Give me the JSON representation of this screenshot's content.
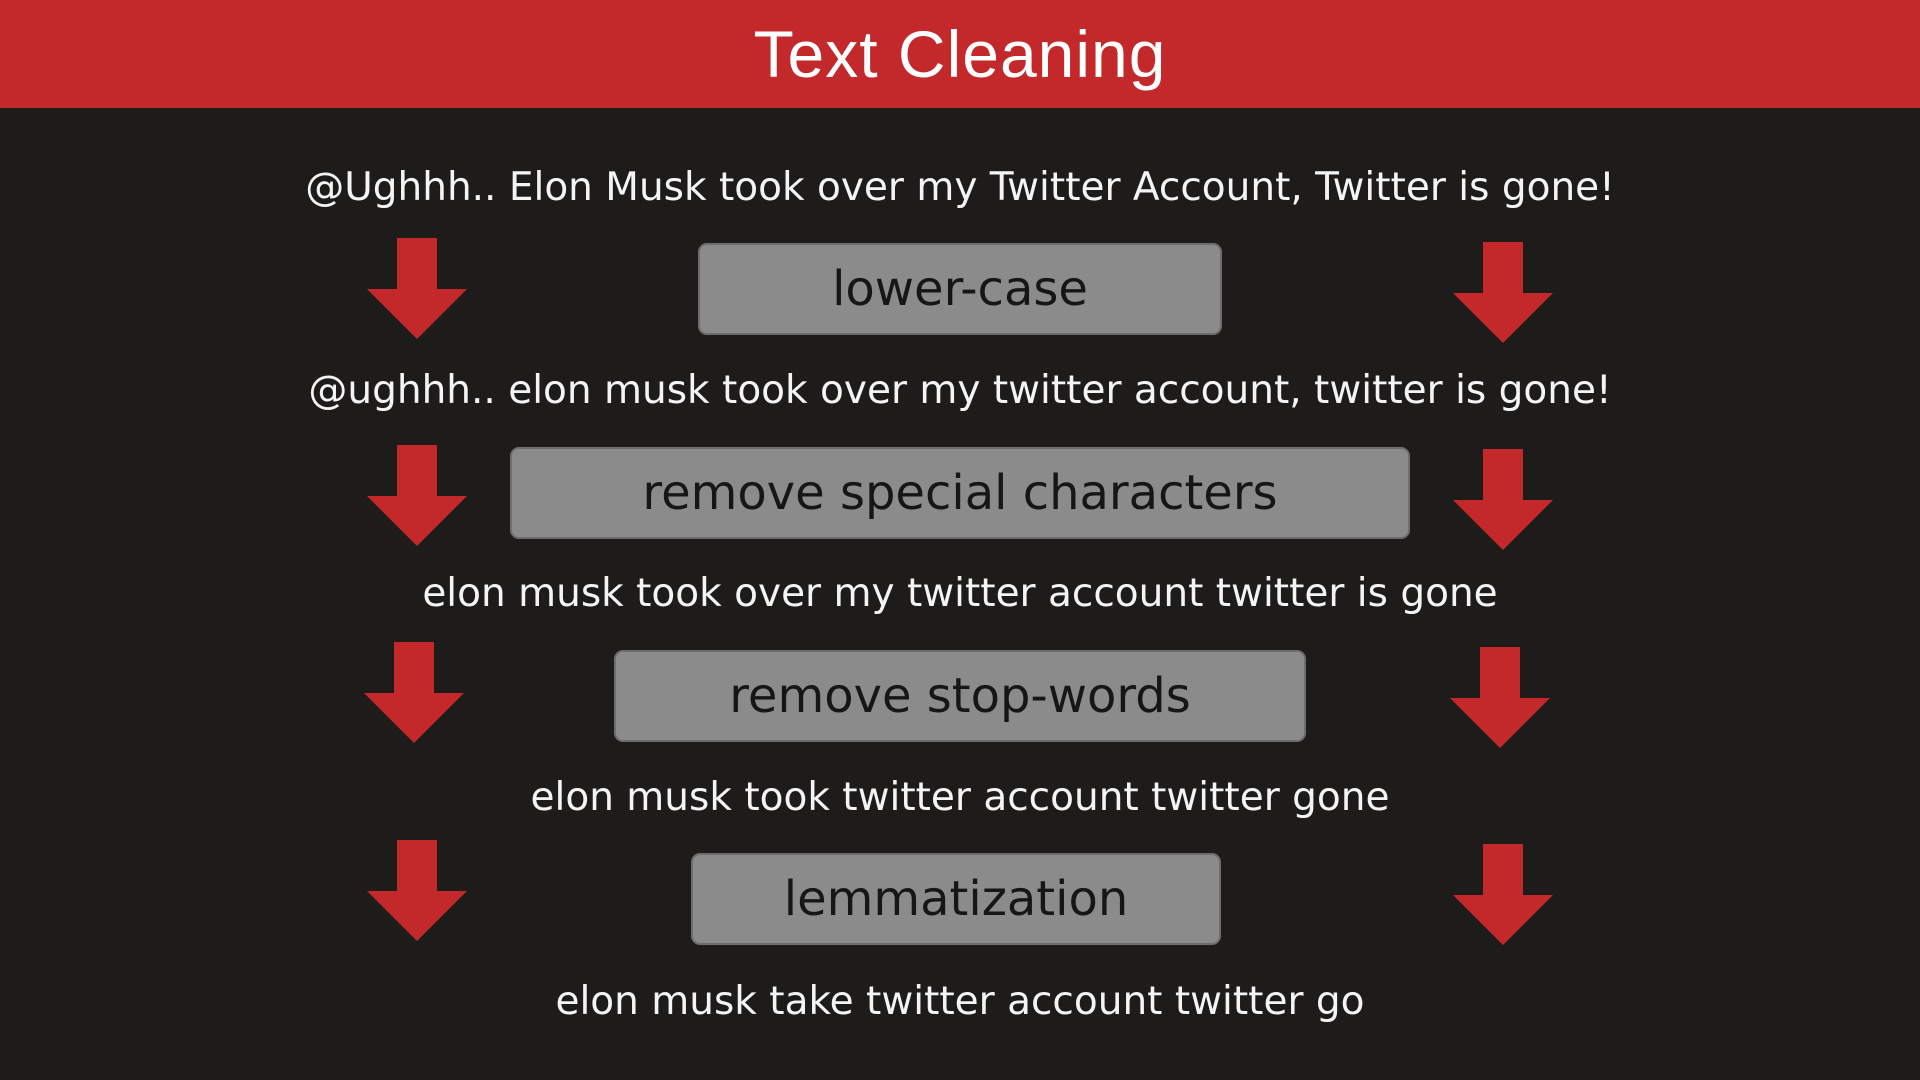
{
  "header": {
    "title": "Text Cleaning"
  },
  "pipeline": {
    "input_text": "@Ughhh.. Elon Musk took over my Twitter Account, Twitter is gone!",
    "steps": [
      {
        "label": "lower-case",
        "output": "@ughhh.. elon musk took over my twitter account, twitter is gone!"
      },
      {
        "label": "remove special characters",
        "output": "elon musk took over my twitter account twitter is gone"
      },
      {
        "label": "remove stop-words",
        "output": "elon musk took twitter account twitter gone"
      },
      {
        "label": "lemmatization",
        "output": "elon musk take twitter account twitter go"
      }
    ]
  },
  "colors": {
    "header_background": "#c3282b",
    "page_background": "#1e1b1b",
    "arrow": "#c3282b",
    "step_box": "#8c8b8b",
    "text": "#f4f4f4"
  },
  "icons": {
    "arrow": "arrow-down-icon"
  }
}
